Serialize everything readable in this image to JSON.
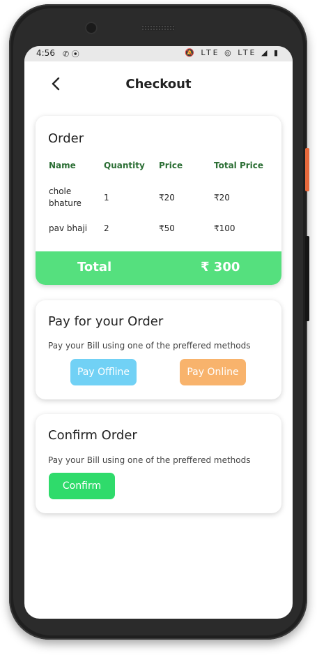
{
  "status_bar": {
    "time": "4:56",
    "left_icons": "✆ ⦿",
    "right_icons": "🔕 LTE ◎ LTE ◢ ▮"
  },
  "header": {
    "title": "Checkout",
    "back_icon": "chevron-left-icon"
  },
  "order": {
    "title": "Order",
    "columns": [
      "Name",
      "Quantity",
      "Price",
      "Total Price"
    ],
    "rows": [
      {
        "name": "chole bhature",
        "quantity": "1",
        "price": "₹20",
        "total": "₹20"
      },
      {
        "name": "pav bhaji",
        "quantity": "2",
        "price": "₹50",
        "total": "₹100"
      }
    ],
    "total_label": "Total",
    "total_value": "₹ 300",
    "accent_color": "#55e07e",
    "header_color": "#2b6e34"
  },
  "payment": {
    "title": "Pay for your Order",
    "subtitle": "Pay your Bill using one of the preffered methods",
    "offline_label": "Pay Offline",
    "online_label": "Pay Online",
    "offline_color": "#71d1f5",
    "online_color": "#f8b36c"
  },
  "confirm": {
    "title": "Confirm Order",
    "subtitle": "Pay your Bill using one of the preffered methods",
    "button_label": "Confirm",
    "button_color": "#2fdb6b"
  }
}
